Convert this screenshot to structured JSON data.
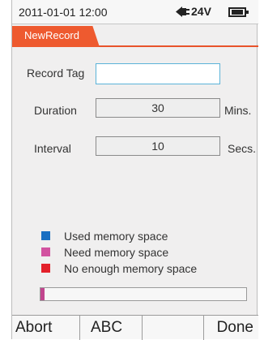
{
  "status": {
    "datetime": "2011-01-01  12:00",
    "voltage": "24V",
    "plug_icon": "plug-icon",
    "battery_icon": "battery-icon"
  },
  "title": "NewRecord",
  "form": {
    "record_tag_label": "Record Tag",
    "record_tag_value": "",
    "duration_label": "Duration",
    "duration_value": "30",
    "duration_unit": "Mins.",
    "interval_label": "Interval",
    "interval_value": "10",
    "interval_unit": "Secs."
  },
  "legend": [
    {
      "label": "Used memory space",
      "color": "#1a6fc2"
    },
    {
      "label": "Need memory space",
      "color": "#d252a0"
    },
    {
      "label": "No enough memory space",
      "color": "#e3202a"
    }
  ],
  "memory": {
    "used_fraction": 0.02,
    "fill_color": "#c2468f"
  },
  "softkeys": {
    "abort": "Abort",
    "abc": "ABC",
    "empty": "",
    "done": "Done"
  },
  "colors": {
    "accent": "#ee5a2f",
    "input_border": "#5bb3d9"
  }
}
